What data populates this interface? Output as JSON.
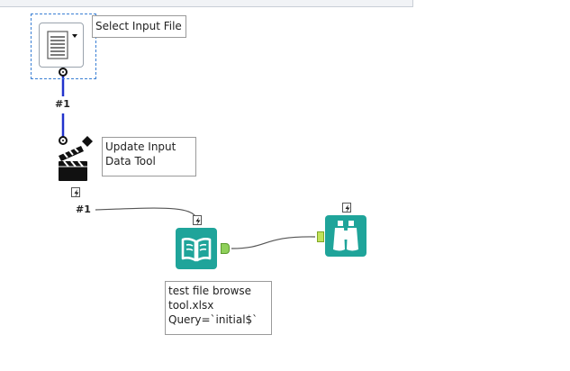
{
  "canvas": {
    "background": "#ffffff",
    "selection_color": "#3a7fd4",
    "tool_accent": "#1fa49a",
    "connection_color": "#2233cc",
    "wire_color": "#555555"
  },
  "tools": {
    "select_input_file": {
      "icon": "document-icon",
      "annotation": "Select Input File",
      "output_connection_label": "#1"
    },
    "update_input_data": {
      "icon": "clapperboard-icon",
      "annotation_lines": [
        "Update Input",
        "Data Tool"
      ],
      "output_connection_label": "#1"
    },
    "input_data": {
      "icon": "book-icon",
      "annotation_lines": [
        "test file browse",
        "tool.xlsx",
        "Query=`initial$`"
      ]
    },
    "browse": {
      "icon": "binoculars-icon"
    }
  }
}
